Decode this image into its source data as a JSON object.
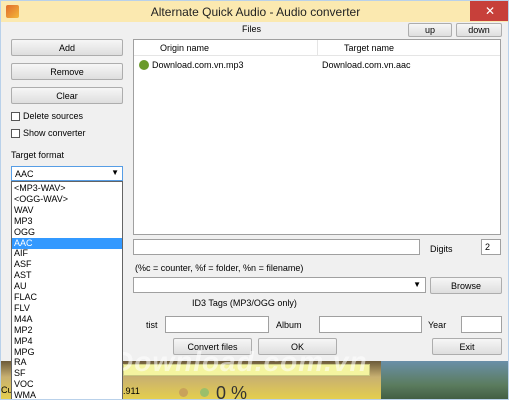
{
  "window": {
    "title": "Alternate Quick Audio - Audio converter",
    "close_glyph": "✕"
  },
  "files": {
    "label": "Files",
    "up_label": "up",
    "down_label": "down",
    "columns": [
      "Origin name",
      "Target name"
    ],
    "rows": [
      {
        "origin": "Download.com.vn.mp3",
        "target": "Download.com.vn.aac"
      }
    ]
  },
  "left_panel": {
    "add_label": "Add",
    "remove_label": "Remove",
    "clear_label": "Clear",
    "delete_sources_label": "Delete sources",
    "show_converter_label": "Show converter",
    "target_format_label": "Target format",
    "target_format_value": "AAC",
    "format_options": [
      "<MP3-WAV>",
      "<OGG-WAV>",
      "WAV",
      "MP3",
      "OGG",
      "AAC",
      "AIF",
      "ASF",
      "AST",
      "AU",
      "FLAC",
      "FLV",
      "M4A",
      "MP2",
      "MP4",
      "MPG",
      "RA",
      "SF",
      "VOC",
      "WMA"
    ],
    "selected_option": "AAC"
  },
  "naming": {
    "digits_label": "Digits",
    "digits_value": "2",
    "hint": "(%c = counter, %f = folder, %n = filename)",
    "browse_label": "Browse"
  },
  "id3": {
    "label": "ID3 Tags (MP3/OGG only)",
    "artist_label_partial": "tist",
    "album_label": "Album",
    "year_label": "Year"
  },
  "actions": {
    "convert_label": "Convert files",
    "ok_label": "OK",
    "exit_label": "Exit"
  },
  "background": {
    "status_prefix": "Cu",
    "status_number": "3.911",
    "percent_partial": "0 %",
    "watermark": "Download.com.vn"
  },
  "colors": {
    "titlebar": "#fbe9b0",
    "close": "#c7403a",
    "selection": "#3399ff"
  }
}
